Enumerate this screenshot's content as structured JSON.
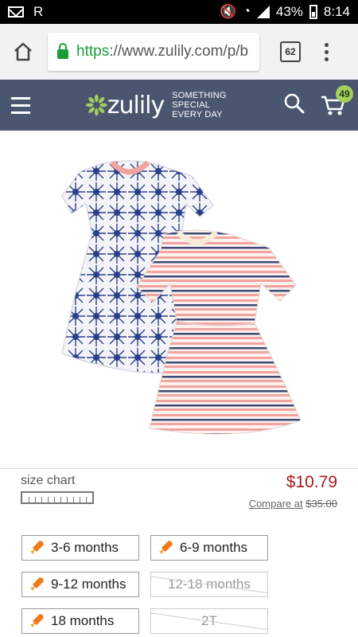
{
  "status_bar": {
    "left_text": "R",
    "battery": "43%",
    "time": "8:14"
  },
  "browser": {
    "url_scheme": "https",
    "url_rest": "://www.zulily.com/p/b",
    "tab_count": "62"
  },
  "site_header": {
    "logo_text": "zulily",
    "tagline_line1": "SOMETHING SPECIAL",
    "tagline_line2": "EVERY DAY",
    "cart_count": "49"
  },
  "product": {
    "image_icon": "two-dresses-image",
    "size_chart_label": "size chart",
    "price": "$10.79",
    "compare_label": "Compare at",
    "compare_price": "$35.00"
  },
  "sizes": [
    {
      "label": "3-6 months",
      "available": true
    },
    {
      "label": "6-9 months",
      "available": true
    },
    {
      "label": "9-12 months",
      "available": true
    },
    {
      "label": "12-18 months",
      "available": false
    },
    {
      "label": "18 months",
      "available": true
    },
    {
      "label": "2T",
      "available": false
    }
  ],
  "colors": {
    "header_bg": "#4a5570",
    "price": "#a9181e",
    "cart_badge": "#a3cf5a",
    "rocket": "#f07a1a"
  }
}
